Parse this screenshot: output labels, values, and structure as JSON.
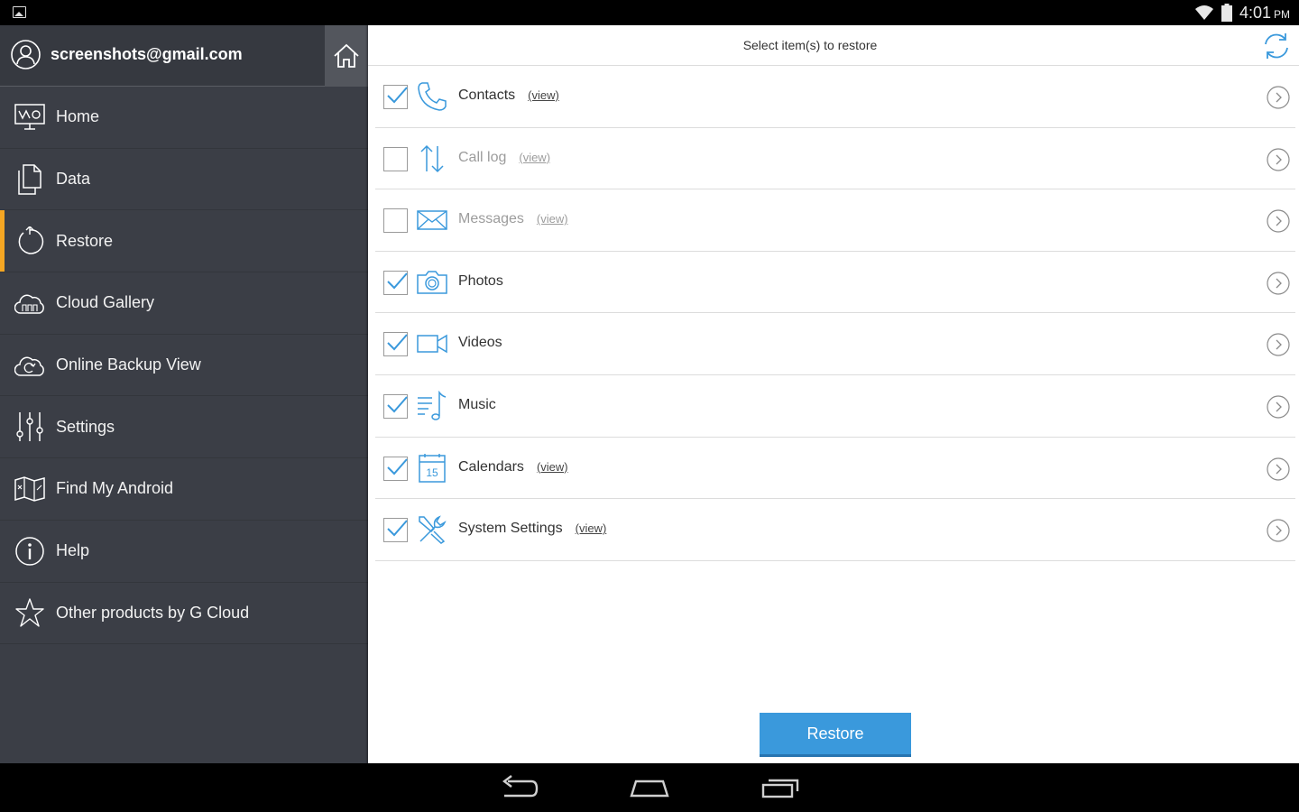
{
  "status_bar": {
    "time": "4:01",
    "ampm": "PM"
  },
  "sidebar": {
    "email": "screenshots@gmail.com",
    "items": [
      {
        "label": "Home",
        "icon": "home-board-icon"
      },
      {
        "label": "Data",
        "icon": "documents-icon"
      },
      {
        "label": "Restore",
        "icon": "restore-icon",
        "active": true
      },
      {
        "label": "Cloud Gallery",
        "icon": "cloud-gallery-icon"
      },
      {
        "label": "Online Backup View",
        "icon": "cloud-sync-icon"
      },
      {
        "label": "Settings",
        "icon": "sliders-icon"
      },
      {
        "label": "Find My Android",
        "icon": "map-icon"
      },
      {
        "label": "Help",
        "icon": "info-icon"
      },
      {
        "label": "Other products by G Cloud",
        "icon": "star-icon"
      }
    ],
    "active_color": "#f5a623"
  },
  "main": {
    "title": "Select item(s) to restore",
    "rows": [
      {
        "name": "Contacts",
        "view": "(view)",
        "checked": true,
        "icon": "phone-icon"
      },
      {
        "name": "Call log",
        "view": "(view)",
        "checked": false,
        "icon": "call-log-arrows-icon"
      },
      {
        "name": "Messages",
        "view": "(view)",
        "checked": false,
        "icon": "envelope-icon"
      },
      {
        "name": "Photos",
        "checked": true,
        "icon": "camera-icon"
      },
      {
        "name": "Videos",
        "checked": true,
        "icon": "video-camera-icon"
      },
      {
        "name": "Music",
        "checked": true,
        "icon": "music-icon"
      },
      {
        "name": "Calendars",
        "view": "(view)",
        "checked": true,
        "icon": "calendar-icon",
        "calendar_day": "15"
      },
      {
        "name": "System Settings",
        "view": "(view)",
        "checked": true,
        "icon": "tools-icon"
      }
    ],
    "restore_label": "Restore",
    "accent": "#3a99dc"
  }
}
